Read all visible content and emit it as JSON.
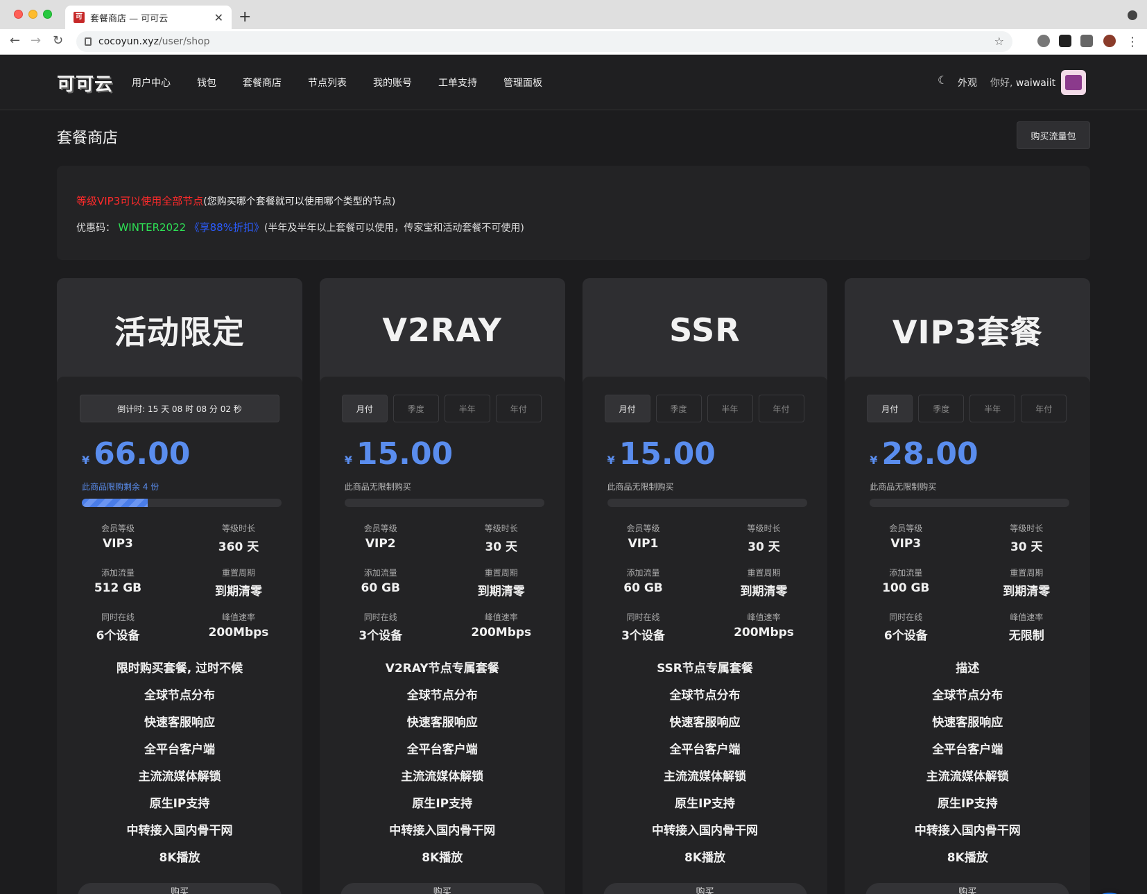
{
  "browser": {
    "tab_title": "套餐商店 — 可可云",
    "favicon_text": "可",
    "newtab_label": "+",
    "url_host": "cocoyun.xyz",
    "url_path": "/user/shop"
  },
  "nav": {
    "brand": "可可云",
    "items": [
      {
        "label": "用户中心"
      },
      {
        "label": "钱包"
      },
      {
        "label": "套餐商店"
      },
      {
        "label": "节点列表"
      },
      {
        "label": "我的账号"
      },
      {
        "label": "工单支持"
      },
      {
        "label": "管理面板"
      }
    ],
    "appearance_label": "外观",
    "greeting_prefix": "你好,",
    "username": "waiwaiit"
  },
  "page": {
    "title": "套餐商店",
    "buy_traffic_label": "购买流量包"
  },
  "notice": {
    "line1_red": "等级VIP3可以使用全部节点",
    "line1_rest": "(您购买哪个套餐就可以使用哪个类型的节点)",
    "line2_prefix": "优惠码：",
    "coupon_code": "WINTER2022",
    "coupon_discount": "《享88%折扣》",
    "line2_rest": "(半年及半年以上套餐可以使用，传家宝和活动套餐不可使用)"
  },
  "period_tabs": [
    "月付",
    "季度",
    "半年",
    "年付"
  ],
  "plans": [
    {
      "name": "活动限定",
      "countdown": "倒计时:  15 天 08 时 08 分 02 秒",
      "currency": "¥",
      "price": "66.00",
      "limit_text": "此商品限购剩余 4 份",
      "progress": 0.33,
      "stats": {
        "level_label": "会员等级",
        "level": "VIP3",
        "duration_label": "等级时长",
        "duration": "360 天",
        "traffic_label": "添加流量",
        "traffic": "512 GB",
        "reset_label": "重置周期",
        "reset": "到期清零",
        "devices_label": "同时在线",
        "devices": "6个设备",
        "speed_label": "峰值速率",
        "speed": "200Mbps"
      },
      "features": [
        "限时购买套餐, 过时不候",
        "全球节点分布",
        "快速客服响应",
        "全平台客户端",
        "主流流媒体解锁",
        "原生IP支持",
        "中转接入国内骨干网",
        "8K播放"
      ],
      "buy_label": "购买"
    },
    {
      "name": "V2RAY",
      "currency": "¥",
      "price": "15.00",
      "limit_text": "此商品无限制购买",
      "progress": 0,
      "stats": {
        "level_label": "会员等级",
        "level": "VIP2",
        "duration_label": "等级时长",
        "duration": "30 天",
        "traffic_label": "添加流量",
        "traffic": "60 GB",
        "reset_label": "重置周期",
        "reset": "到期清零",
        "devices_label": "同时在线",
        "devices": "3个设备",
        "speed_label": "峰值速率",
        "speed": "200Mbps"
      },
      "features": [
        "V2RAY节点专属套餐",
        "全球节点分布",
        "快速客服响应",
        "全平台客户端",
        "主流流媒体解锁",
        "原生IP支持",
        "中转接入国内骨干网",
        "8K播放"
      ],
      "buy_label": "购买"
    },
    {
      "name": "SSR",
      "currency": "¥",
      "price": "15.00",
      "limit_text": "此商品无限制购买",
      "progress": 0,
      "stats": {
        "level_label": "会员等级",
        "level": "VIP1",
        "duration_label": "等级时长",
        "duration": "30 天",
        "traffic_label": "添加流量",
        "traffic": "60 GB",
        "reset_label": "重置周期",
        "reset": "到期清零",
        "devices_label": "同时在线",
        "devices": "3个设备",
        "speed_label": "峰值速率",
        "speed": "200Mbps"
      },
      "features": [
        "SSR节点专属套餐",
        "全球节点分布",
        "快速客服响应",
        "全平台客户端",
        "主流流媒体解锁",
        "原生IP支持",
        "中转接入国内骨干网",
        "8K播放"
      ],
      "buy_label": "购买"
    },
    {
      "name": "VIP3套餐",
      "currency": "¥",
      "price": "28.00",
      "limit_text": "此商品无限制购买",
      "progress": 0,
      "stats": {
        "level_label": "会员等级",
        "level": "VIP3",
        "duration_label": "等级时长",
        "duration": "30 天",
        "traffic_label": "添加流量",
        "traffic": "100 GB",
        "reset_label": "重置周期",
        "reset": "到期清零",
        "devices_label": "同时在线",
        "devices": "6个设备",
        "speed_label": "峰值速率",
        "speed": "无限制"
      },
      "features": [
        "描述",
        "全球节点分布",
        "快速客服响应",
        "全平台客户端",
        "主流流媒体解锁",
        "原生IP支持",
        "中转接入国内骨干网",
        "8K播放"
      ],
      "buy_label": "购买"
    }
  ],
  "colors": {
    "accent_blue": "#5a8dee",
    "notice_red": "#ff2a2a",
    "coupon_green": "#2ee055",
    "coupon_blue": "#2b5cff",
    "chat_fab": "#1a73e8"
  }
}
